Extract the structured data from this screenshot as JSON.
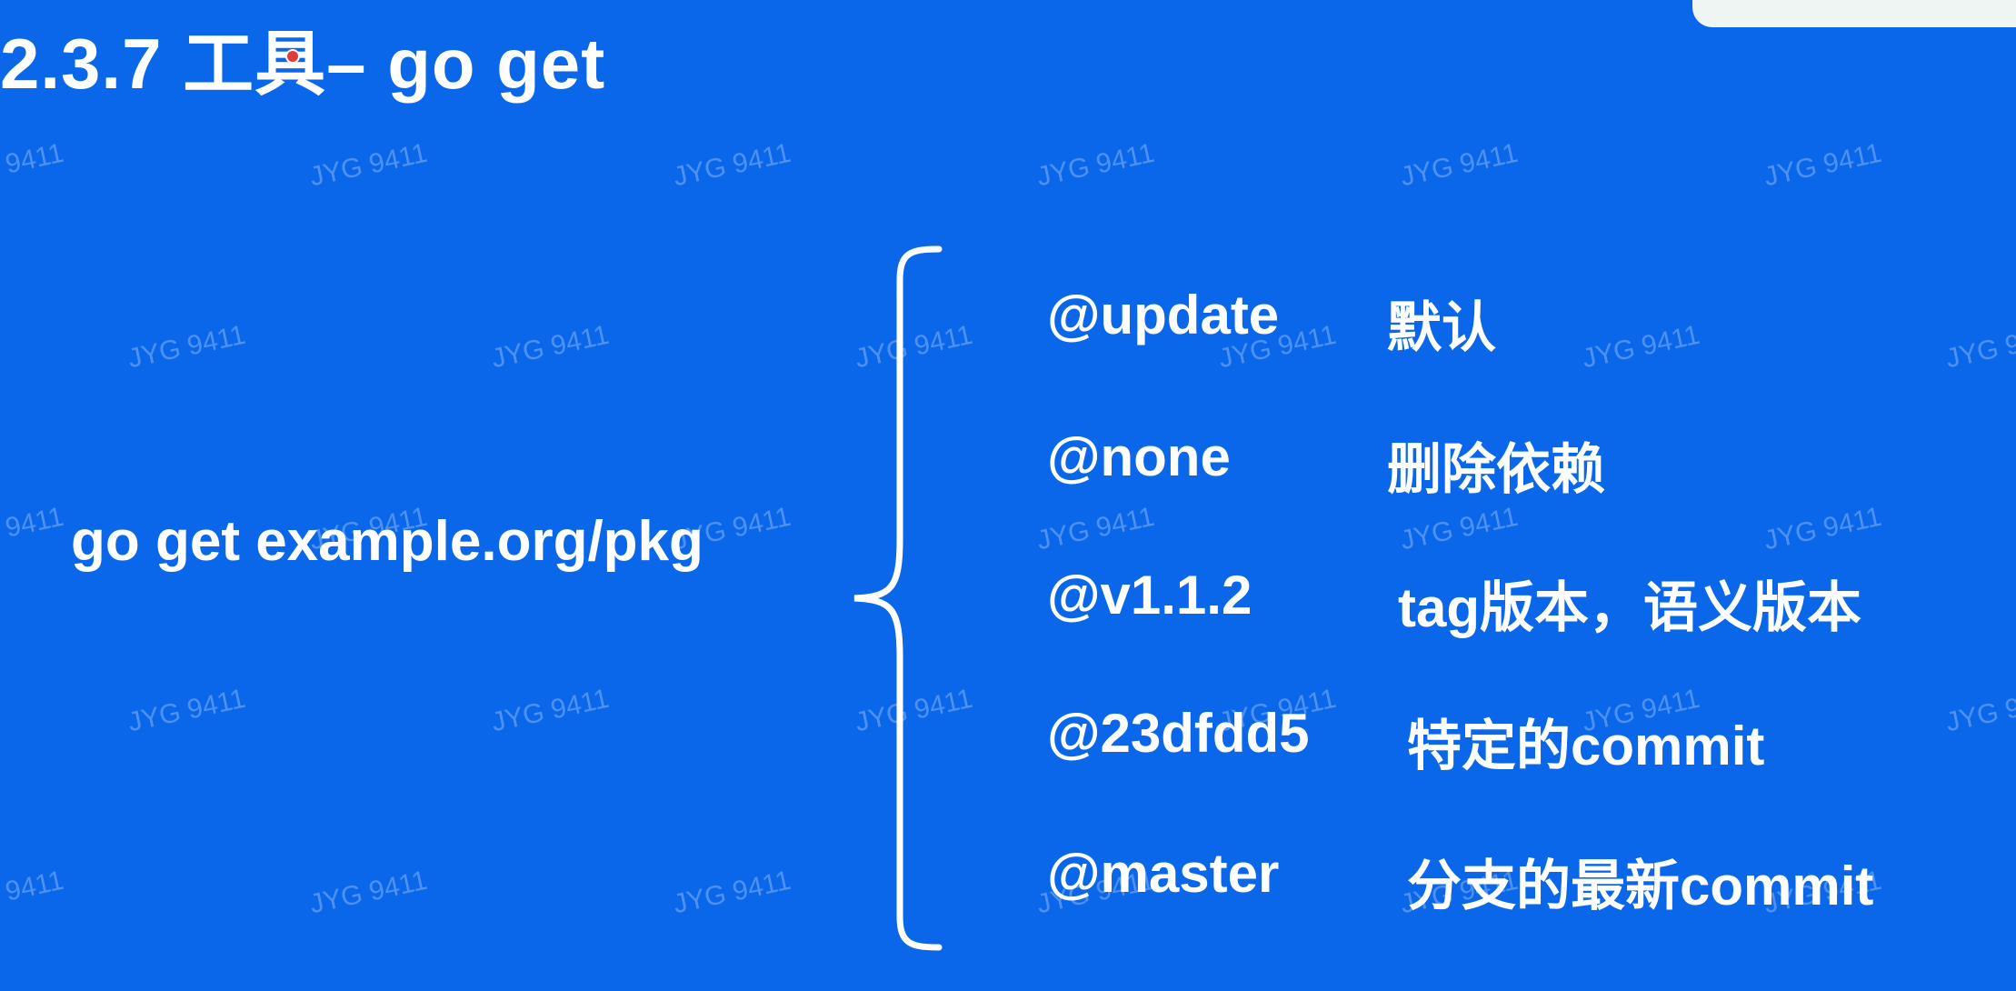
{
  "slide": {
    "title": "2.3.7 工具– go get",
    "command": "go get example.org/pkg",
    "options": [
      {
        "key": "@update",
        "desc": "默认"
      },
      {
        "key": "@none",
        "desc": "删除依赖"
      },
      {
        "key": "@v1.1.2",
        "desc": "tag版本，语义版本"
      },
      {
        "key": "@23dfdd5",
        "desc": "特定的commit"
      },
      {
        "key": "@master",
        "desc": "分支的最新commit"
      }
    ],
    "watermark": "JYG 9411"
  },
  "colors": {
    "background": "#0a67ea",
    "text": "#ffffff",
    "corner_panel": "#eef5f3"
  }
}
